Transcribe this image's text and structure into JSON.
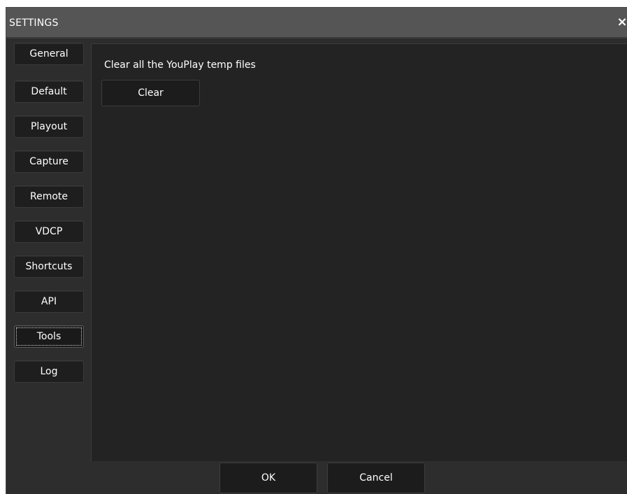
{
  "window": {
    "title": "SETTINGS",
    "close_glyph": "×"
  },
  "sidebar": {
    "items": [
      {
        "label": "General"
      },
      {
        "label": "Default"
      },
      {
        "label": "Playout"
      },
      {
        "label": "Capture"
      },
      {
        "label": "Remote"
      },
      {
        "label": "VDCP"
      },
      {
        "label": "Shortcuts"
      },
      {
        "label": "API"
      },
      {
        "label": "Tools",
        "active": true
      },
      {
        "label": "Log"
      }
    ]
  },
  "tools_panel": {
    "description": "Clear all the YouPlay temp files",
    "clear_label": "Clear"
  },
  "footer": {
    "ok_label": "OK",
    "cancel_label": "Cancel"
  },
  "colors": {
    "titlebar": "#555555",
    "window_bg": "#2d2d2d",
    "panel_bg": "#232323",
    "button_bg": "#1c1c1c",
    "text": "#ffffff"
  }
}
